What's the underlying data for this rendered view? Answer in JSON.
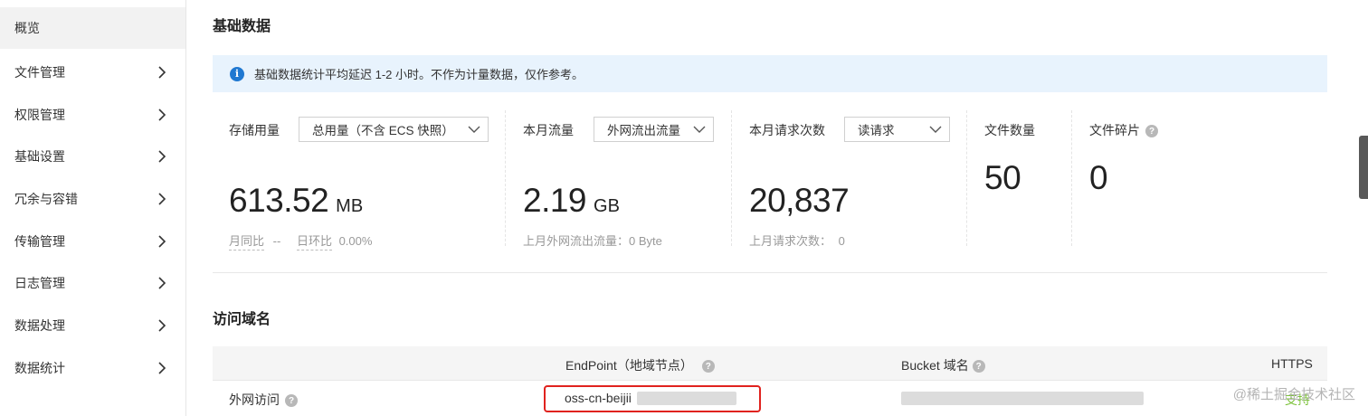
{
  "sidebar": {
    "items": [
      {
        "label": "概览",
        "active": true,
        "has_chevron": false
      },
      {
        "label": "文件管理",
        "active": false,
        "has_chevron": true
      },
      {
        "label": "权限管理",
        "active": false,
        "has_chevron": true
      },
      {
        "label": "基础设置",
        "active": false,
        "has_chevron": true
      },
      {
        "label": "冗余与容错",
        "active": false,
        "has_chevron": true
      },
      {
        "label": "传输管理",
        "active": false,
        "has_chevron": true
      },
      {
        "label": "日志管理",
        "active": false,
        "has_chevron": true
      },
      {
        "label": "数据处理",
        "active": false,
        "has_chevron": true
      },
      {
        "label": "数据统计",
        "active": false,
        "has_chevron": true
      }
    ],
    "chevron_icon": "chevron-right-icon"
  },
  "basic": {
    "title": "基础数据",
    "notice": "基础数据统计平均延迟 1-2 小时。不作为计量数据，仅作参考。",
    "notice_icon": "info-icon"
  },
  "storage": {
    "label": "存储用量",
    "select": "总用量（不含 ECS 快照）",
    "value": "613.52",
    "unit": "MB",
    "yoy_label": "月同比",
    "yoy_value": "--",
    "mom_label": "日环比",
    "mom_value": "0.00%"
  },
  "traffic": {
    "label": "本月流量",
    "select": "外网流出流量",
    "value": "2.19",
    "unit": "GB",
    "sub": "上月外网流出流量：0 Byte"
  },
  "requests": {
    "label": "本月请求次数",
    "select": "读请求",
    "value": "20,837",
    "sub_label": "上月请求次数：",
    "sub_value": "0"
  },
  "files": {
    "label": "文件数量",
    "value": "50"
  },
  "fragments": {
    "label": "文件碎片",
    "value": "0"
  },
  "domain": {
    "title": "访问域名",
    "columns": [
      "EndPoint（地域节点）",
      "Bucket 域名",
      "HTTPS"
    ],
    "row": {
      "label": "外网访问",
      "endpoint": "oss-cn-beijii",
      "https": "支持"
    }
  },
  "watermark": "@稀土掘金技术社区",
  "colors": {
    "accent": "#1f78d1",
    "notice_bg": "#e8f3fd",
    "highlight": "#e0221e",
    "https": "#7cc23a"
  }
}
